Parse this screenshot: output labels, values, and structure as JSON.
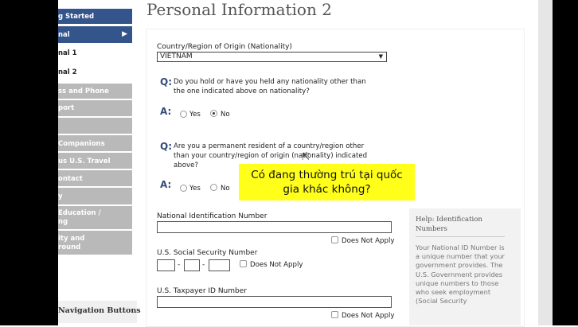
{
  "sidebar": {
    "items": [
      {
        "label": "g Started",
        "style": "dark"
      },
      {
        "label": "nal",
        "style": "dark-active"
      },
      {
        "label": "nal 1",
        "style": "white"
      },
      {
        "label": "nal 2",
        "style": "white"
      },
      {
        "label": "ss and Phone",
        "style": "gray"
      },
      {
        "label": "port",
        "style": "gray"
      },
      {
        "label": "",
        "style": "gray"
      },
      {
        "label": "Companions",
        "style": "gray"
      },
      {
        "label": "us U.S. Travel",
        "style": "gray"
      },
      {
        "label": "ontact",
        "style": "gray"
      },
      {
        "label": "y",
        "style": "gray"
      },
      {
        "label": "Education /",
        "label2": "ng",
        "style": "gray"
      },
      {
        "label": "ity and",
        "label2": "round",
        "style": "gray"
      }
    ],
    "active_arrow": "▶",
    "nav_buttons_label": "Navigation Buttons"
  },
  "page": {
    "title": "Personal Information 2"
  },
  "form": {
    "country_label": "Country/Region of Origin (Nationality)",
    "country_value": "VIETNAM",
    "q_marker": "Q:",
    "a_marker": "A:",
    "q1_line1": "Do you hold or have you held any nationality other than",
    "q1_line2": "the one indicated above on nationality?",
    "q1_selected": "No",
    "q2_line1": "Are you a permanent resident of a country/region other",
    "q2_line2": "than your country/region of origin (nationality) indicated",
    "q2_line3": "above?",
    "yes_label": "Yes",
    "no_label": "No",
    "nin_label": "National Identification Number",
    "ssn_label": "U.S. Social Security Number",
    "ssn_dash": "-",
    "tin_label": "U.S. Taxpayer ID Number",
    "does_not_apply": "Does Not Apply"
  },
  "help": {
    "title": "Help: Identification Numbers",
    "text": "Your National ID Number is a unique number that your government provides. The U.S. Government provides unique numbers to those who seek employment (Social Security"
  },
  "overlay": {
    "tooltip_line1": "Có đang thường trú tại quốc",
    "tooltip_line2": "gia khác không?"
  },
  "colors": {
    "nav_dark": "#34558b",
    "nav_gray": "#b9b9b9",
    "tooltip": "#ffff1a",
    "qa_accent": "#334a7a"
  }
}
